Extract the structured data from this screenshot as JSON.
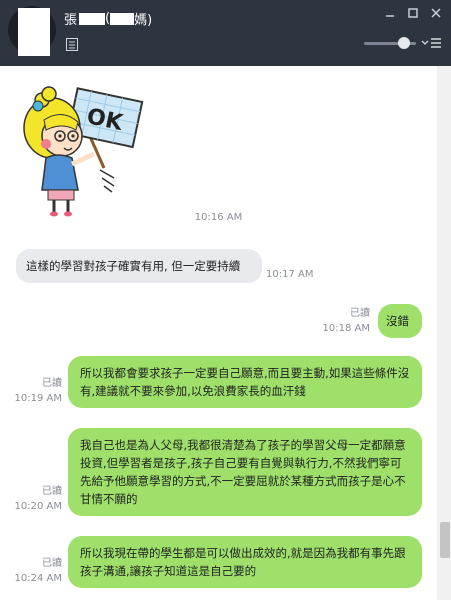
{
  "header": {
    "name_prefix": "張",
    "name_suffix": "媽)",
    "open_paren": "(",
    "window_buttons": [
      "minimize-icon",
      "maximize-icon",
      "close-icon"
    ]
  },
  "colors": {
    "header_bg": "#2f3441",
    "outgoing_bubble": "#9ee06a",
    "incoming_bubble": "#e9eaed"
  },
  "messages": [
    {
      "type": "sticker",
      "sticker_text": "OK",
      "time": "10:16 AM"
    },
    {
      "type": "incoming",
      "text": "這樣的學習對孩子確實有用, 但一定要持續",
      "time": "10:17 AM"
    },
    {
      "type": "outgoing",
      "read": "已讀",
      "time": "10:18 AM",
      "text": "沒錯"
    },
    {
      "type": "outgoing",
      "read": "已讀",
      "time": "10:19 AM",
      "text": "所以我都會要求孩子一定要自己願意,而且要主動,如果這些條件沒有,建議就不要來參加,以免浪費家長的血汗錢"
    },
    {
      "type": "outgoing",
      "read": "已讀",
      "time": "10:20 AM",
      "text": "我自己也是為人父母,我都很清楚為了孩子的學習父母一定都願意投資,但學習者是孩子,孩子自己要有自覺與執行力,不然我們寧可先給予他願意學習的方式,不一定要屈就於某種方式而孩子是心不甘情不願的"
    },
    {
      "type": "outgoing",
      "read": "已讀",
      "time": "10:24 AM",
      "text": "所以我現在帶的學生都是可以做出成效的,就是因為我都有事先跟孩子溝通,讓孩子知道這是自己要的"
    }
  ]
}
